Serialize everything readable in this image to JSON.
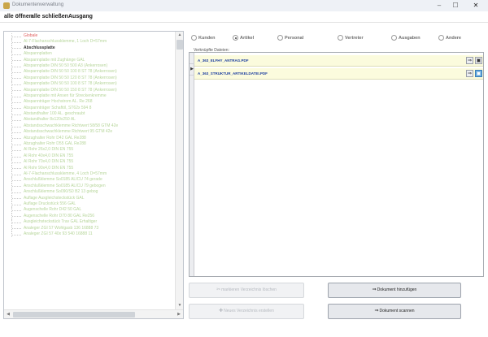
{
  "window": {
    "title": "Dokumentenverwaltung",
    "controls": {
      "minimize": "–",
      "maximize": "☐",
      "close": "✕"
    }
  },
  "menu": {
    "items": [
      "alle öffnen",
      "alle schließen",
      "Ausgang"
    ]
  },
  "tree": {
    "items": [
      "Globale",
      "Al-7-Flachanschlussklemme, 1 Loch D=57mm",
      "Abschlussplatte",
      "Abspannplatten",
      "Abspannplatte mit Zughänge GAL",
      "Abspannplatte DIN 50 50 500 A3 (Ankerrosen)",
      "Abspannplatte DIN 50 50 100 8 ST 78 (Ankerrosen)",
      "Abspannplatte DIN 50 50 120 8 ST 78 (Ankerrosen)",
      "Abspannplatte DIN 50 50 100 8 ST 78 (Ankerrosen)",
      "Abspannplatte DIN 50 50 150 8 ST 78 (Ankerrosen)",
      "Abspannplatte mit Ansen für Streckenkremme",
      "Abspannträger Hochstrom AL. Re 268",
      "Abspannträger Schaftöl, ST62x 594 8",
      "Abstandhalter 100 AL. geschraubt",
      "Abstandhalter 8x120x250 AL",
      "Abstandsschwachklemme Richtwert 58/58 GTM 42e",
      "Abstandsschwachklemme Richtwert 95 GTM 42e",
      "Abzughalter Rohr D42 GAL Re288",
      "Abzughalter Rohr D55 GAL Re288",
      "Al Rohr 26x2,0 DIN EN 755",
      "Al Rohr 40x4,0 DIN EN 755",
      "Al Rohr 70x4,0 DIN EN 755",
      "Al Rohr 90x4,0 DIN EN 755",
      "Al-7-Flachanschlussklemme, 4 Loch D=57mm",
      "Anschlußklemme So0185 ALICU 74 gerade",
      "Anschlußklemme So0185 ALICU 79 gebogen",
      "Anschlußklemme So090/S0 B2 13 gebog",
      "Auflage Ausgleichsteckstück GAL",
      "Auflage Druckstück 556 GAL",
      "Augenschelle Rohr D42 50 GAL",
      "Augenschelle Rohr D70 80 GAL Re256",
      "Ausgleichsteckstück Trav GAL Erhaltiger",
      "Analeger ZGI 57 Wohlgasb 136 16888 73",
      "Analeger ZGI 57 40x 93 540 16888 11"
    ]
  },
  "filters": {
    "options": [
      "Kunden",
      "Artikel",
      "Personal",
      "Vertreter",
      "Ausgaben",
      "Andere"
    ],
    "selected": "Artikel"
  },
  "documents": {
    "label": "Verknüpfte Dateien:",
    "files": [
      "A_363_ELFHY_ANTRAG.PDF",
      "A_363_STRUKTUR_ARTIKELDATEI.PDF"
    ],
    "open_button": "⇒",
    "select_button": "▣"
  },
  "buttons": {
    "mark_folder": "markieren Verzeichnis löschen",
    "new_folder": "Neues Verzeichnis erstellen",
    "add_document": "Dokument hinzufügen",
    "scan_document": "Dokument scannen"
  },
  "icons": {
    "app": "folder-icon",
    "add": "arrow-in-icon",
    "scan": "arrow-in-icon",
    "delete": "scissors-icon",
    "create": "plus-icon"
  },
  "colors": {
    "tree_text": "#b6d59a",
    "tree_first": "#e06060",
    "row_highlight": "#fbfbdd",
    "link": "#1d3fa0",
    "selected_button": "#5ea6de"
  }
}
